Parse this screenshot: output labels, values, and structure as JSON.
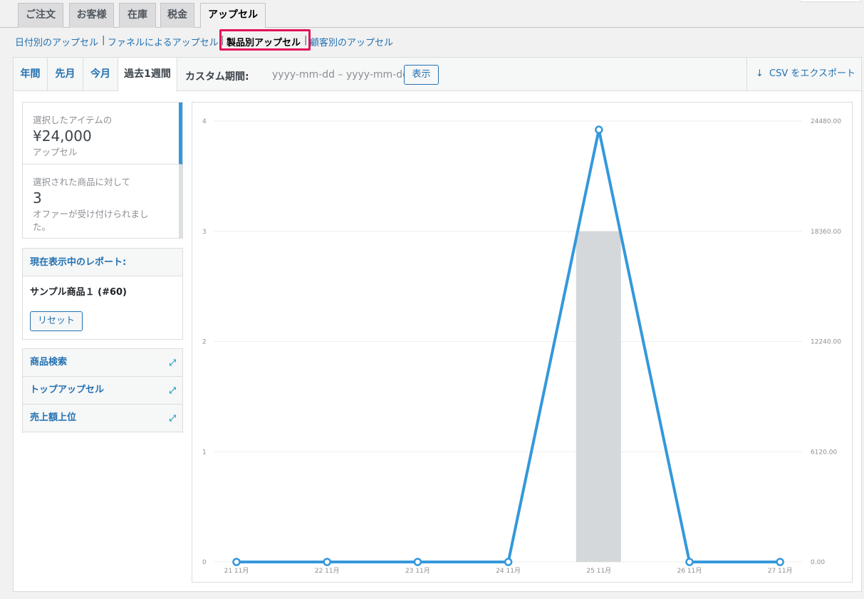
{
  "main_tabs": [
    "ご注文",
    "お客様",
    "在庫",
    "税金",
    "アップセル"
  ],
  "active_main_tab": "アップセル",
  "sub_nav": {
    "items": [
      "日付別のアップセル",
      "ファネルによるアップセル",
      "製品別アップセル",
      "顧客別のアップセル"
    ],
    "separator": "|",
    "current": "製品別アップセル"
  },
  "range_tabs": [
    "年間",
    "先月",
    "今月",
    "過去1週間"
  ],
  "active_range": "過去1週間",
  "custom_range": {
    "label": "カスタム期間:",
    "dates": "yyyy-mm-dd – yyyy-mm-dd",
    "submit_label": "表示"
  },
  "export": {
    "arrow": "↓",
    "label": "CSV をエクスポート"
  },
  "legend": [
    {
      "caption": "選択したアイテムの",
      "amount": "¥24,000",
      "sub": "アップセル",
      "color": "#3498db"
    },
    {
      "caption": "選択された商品に対して",
      "amount": "3",
      "sub": "オファーが受け付けられました。",
      "color": "#dbe1e3"
    }
  ],
  "current_report": {
    "title": "現在表示中のレポート:",
    "product": "サンプル商品１ (#60)",
    "reset_label": "リセット"
  },
  "widgets": [
    {
      "label": "商品検索",
      "icon": "expand-icon",
      "glyph": "⤢"
    },
    {
      "label": "トップアップセル",
      "icon": "expand-icon",
      "glyph": "⤢"
    },
    {
      "label": "売上額上位",
      "icon": "expand-icon",
      "glyph": "⤢"
    }
  ],
  "colors": {
    "line": "#3498db",
    "bar": "#d4d8da",
    "highlight": "#e2135a",
    "link": "#2271b1"
  },
  "chart_data": {
    "type": "bar+line",
    "categories": [
      "21 11月",
      "22 11月",
      "23 11月",
      "24 11月",
      "25 11月",
      "26 11月",
      "27 11月"
    ],
    "left_axis": {
      "ticks": [
        "0",
        "1",
        "2",
        "3",
        "4"
      ],
      "ylim": [
        0,
        4
      ]
    },
    "right_axis": {
      "ticks": [
        "0.00",
        "6120.00",
        "12240.00",
        "18360.00",
        "24480.00"
      ],
      "ylim": [
        0,
        24480
      ]
    },
    "series": [
      {
        "type": "bar",
        "axis": "left",
        "values": [
          0,
          0,
          0,
          0,
          3,
          0,
          0
        ]
      },
      {
        "type": "line",
        "axis": "right",
        "values": [
          0,
          0,
          0,
          0,
          24000,
          0,
          0
        ]
      }
    ],
    "grid": true
  }
}
